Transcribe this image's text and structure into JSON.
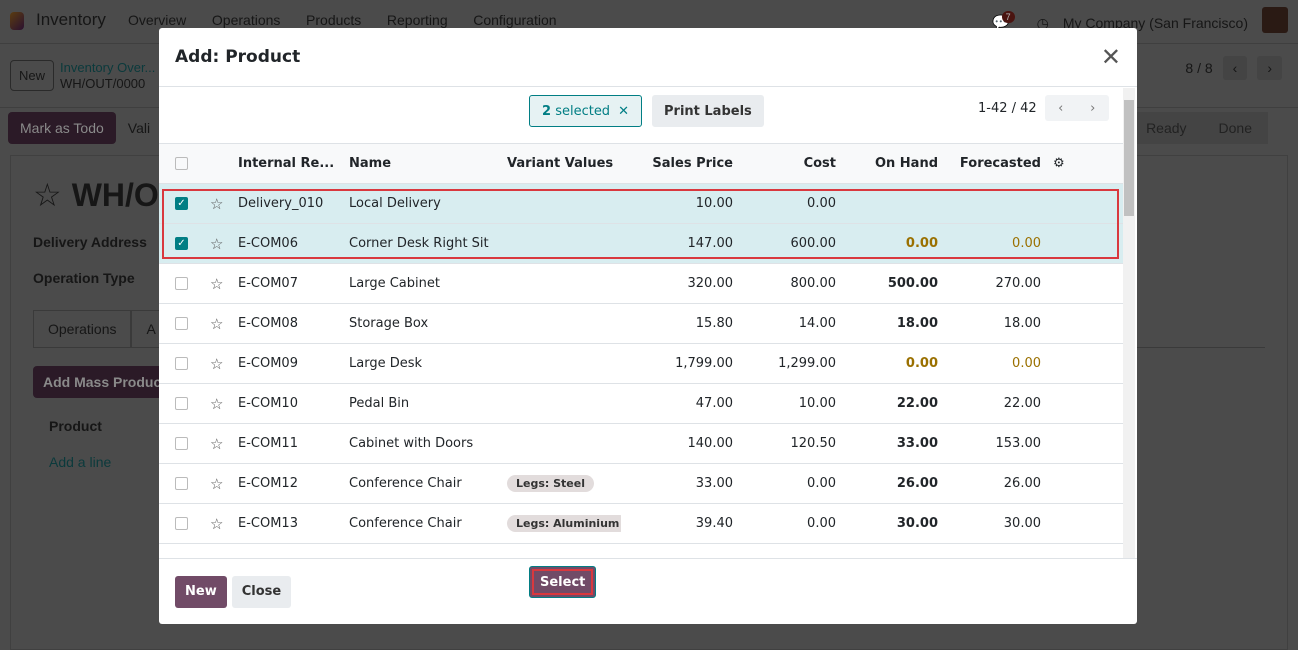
{
  "app": {
    "name": "Inventory",
    "menu": [
      "Overview",
      "Operations",
      "Products",
      "Reporting",
      "Configuration"
    ],
    "notifications": "7",
    "company": "My Company (San Francisco)"
  },
  "control": {
    "new_label": "New",
    "breadcrumb_parent": "Inventory Over...",
    "breadcrumb_current": "WH/OUT/0000",
    "pager": "8 / 8"
  },
  "status": {
    "mark_todo": "Mark as Todo",
    "validate": "Vali",
    "states": [
      "Ready",
      "Done"
    ]
  },
  "form": {
    "title": "WH/O",
    "delivery_address": "Delivery Address",
    "operation_type": "Operation Type",
    "tabs": [
      "Operations",
      "A"
    ],
    "add_mass": "Add Mass Product",
    "product_col": "Product",
    "add_line": "Add a line"
  },
  "modal": {
    "title": "Add: Product",
    "selected_count": "2",
    "selected_label": "selected",
    "print_labels": "Print Labels",
    "pager": "1-42 / 42",
    "columns": [
      "Internal Re...",
      "Name",
      "Variant Values",
      "Sales Price",
      "Cost",
      "On Hand",
      "Forecasted"
    ],
    "rows": [
      {
        "ref": "Delivery_010",
        "name": "Local Delivery",
        "variant": "",
        "price": "10.00",
        "cost": "0.00",
        "onhand": "",
        "forecast": "",
        "checked": true,
        "warn": false
      },
      {
        "ref": "E-COM06",
        "name": "Corner Desk Right Sit",
        "variant": "",
        "price": "147.00",
        "cost": "600.00",
        "onhand": "0.00",
        "forecast": "0.00",
        "checked": true,
        "warn": true
      },
      {
        "ref": "E-COM07",
        "name": "Large Cabinet",
        "variant": "",
        "price": "320.00",
        "cost": "800.00",
        "onhand": "500.00",
        "forecast": "270.00",
        "checked": false,
        "warn": false
      },
      {
        "ref": "E-COM08",
        "name": "Storage Box",
        "variant": "",
        "price": "15.80",
        "cost": "14.00",
        "onhand": "18.00",
        "forecast": "18.00",
        "checked": false,
        "warn": false
      },
      {
        "ref": "E-COM09",
        "name": "Large Desk",
        "variant": "",
        "price": "1,799.00",
        "cost": "1,299.00",
        "onhand": "0.00",
        "forecast": "0.00",
        "checked": false,
        "warn": true
      },
      {
        "ref": "E-COM10",
        "name": "Pedal Bin",
        "variant": "",
        "price": "47.00",
        "cost": "10.00",
        "onhand": "22.00",
        "forecast": "22.00",
        "checked": false,
        "warn": false
      },
      {
        "ref": "E-COM11",
        "name": "Cabinet with Doors",
        "variant": "",
        "price": "140.00",
        "cost": "120.50",
        "onhand": "33.00",
        "forecast": "153.00",
        "checked": false,
        "warn": false
      },
      {
        "ref": "E-COM12",
        "name": "Conference Chair",
        "variant": "Legs: Steel",
        "price": "33.00",
        "cost": "0.00",
        "onhand": "26.00",
        "forecast": "26.00",
        "checked": false,
        "warn": false
      },
      {
        "ref": "E-COM13",
        "name": "Conference Chair",
        "variant": "Legs: Aluminium",
        "price": "39.40",
        "cost": "0.00",
        "onhand": "30.00",
        "forecast": "30.00",
        "checked": false,
        "warn": false
      }
    ],
    "buttons": {
      "select": "Select",
      "new": "New",
      "close": "Close"
    }
  },
  "colors": {
    "primary": "#714b67",
    "teal": "#017e84",
    "warning": "#9a7000",
    "highlight": "#d9383e"
  }
}
